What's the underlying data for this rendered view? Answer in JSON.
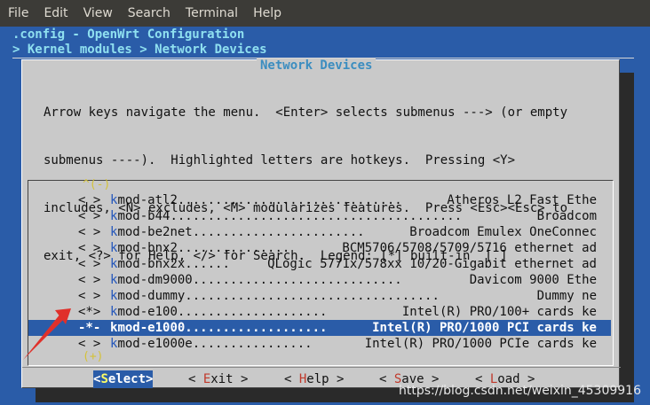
{
  "menubar": {
    "items": [
      "File",
      "Edit",
      "View",
      "Search",
      "Terminal",
      "Help"
    ]
  },
  "header": {
    "title": ".config - OpenWrt Configuration",
    "breadcrumb": "> Kernel modules > Network Devices"
  },
  "dialog": {
    "title": "Network Devices",
    "help_lines": [
      "Arrow keys navigate the menu.  <Enter> selects submenus ---> (or empty",
      "submenus ----).  Highlighted letters are hotkeys.  Pressing <Y>",
      "includes, <N> excludes, <M> modularizes features.  Press <Esc><Esc> to",
      "exit, <?> for Help, </> for Search.  Legend: [*] built-in  [ ]"
    ],
    "scroll_up": "^(-)",
    "scroll_down": "(+)",
    "items": [
      {
        "state": "< >",
        "hotkey": "k",
        "name": "mod-atl2",
        "dots": "..............................",
        "desc": "Atheros L2 Fast Ethe"
      },
      {
        "state": "< >",
        "hotkey": "k",
        "name": "mod-b44",
        "dots": ".......................................",
        "desc": "Broadcom"
      },
      {
        "state": "< >",
        "hotkey": "k",
        "name": "mod-be2net",
        "dots": ".......................",
        "desc": "Broadcom Emulex OneConnec"
      },
      {
        "state": "< >",
        "hotkey": "k",
        "name": "mod-bnx2",
        "dots": "...............",
        "desc": "BCM5706/5708/5709/5716 ethernet ad"
      },
      {
        "state": "< >",
        "hotkey": "k",
        "name": "mod-bnx2x",
        "dots": "......",
        "desc": "QLogic 5771x/578xx 10/20-Gigabit ethernet ad"
      },
      {
        "state": "< >",
        "hotkey": "k",
        "name": "mod-dm9000",
        "dots": "............................",
        "desc": "Davicom 9000 Ethe"
      },
      {
        "state": "< >",
        "hotkey": "k",
        "name": "mod-dummy",
        "dots": "..................................",
        "desc": "Dummy ne"
      },
      {
        "state": "<*>",
        "hotkey": "k",
        "name": "mod-e100",
        "dots": "....................",
        "desc": "Intel(R) PRO/100+ cards ke"
      },
      {
        "state": "-*-",
        "hotkey": "k",
        "name": "mod-e1000",
        "dots": "...................",
        "desc": "Intel(R) PRO/1000 PCI cards ke",
        "selected": true
      },
      {
        "state": "< >",
        "hotkey": "k",
        "name": "mod-e1000e",
        "dots": "................",
        "desc": "Intel(R) PRO/1000 PCIe cards ke"
      }
    ],
    "buttons": [
      {
        "open": "<",
        "hotkey": "S",
        "rest": "elect",
        "close": ">",
        "active": true
      },
      {
        "open": "< ",
        "hotkey": "E",
        "rest": "xit",
        "close": " >"
      },
      {
        "open": "< ",
        "hotkey": "H",
        "rest": "elp",
        "close": " >"
      },
      {
        "open": "< ",
        "hotkey": "S",
        "rest": "ave",
        "close": " >"
      },
      {
        "open": "< ",
        "hotkey": "L",
        "rest": "oad",
        "close": " >"
      }
    ]
  },
  "watermark": "https://blog.csdn.net/weixin_45309916",
  "colors": {
    "terminal_bg": "#2a5ca8",
    "dialog_bg": "#c9c9c9",
    "header_text": "#8fe0f0",
    "annotation_arrow": "#e0302a"
  }
}
